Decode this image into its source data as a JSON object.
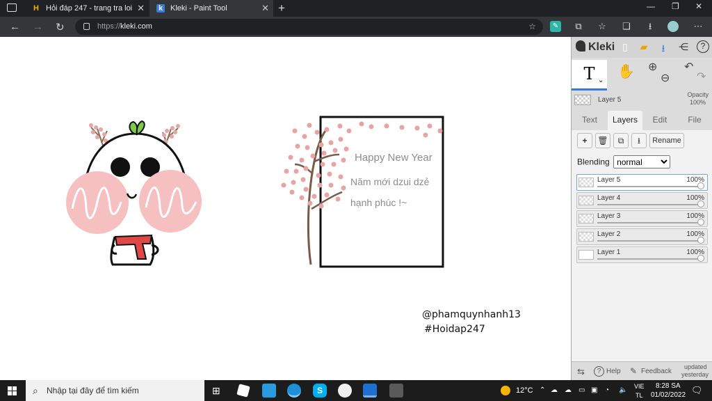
{
  "browser": {
    "tabs": [
      {
        "favicon": "hoidap-favicon",
        "title": "Hỏi đáp 247 - trang tra loi",
        "active": false
      },
      {
        "favicon": "kleki-favicon",
        "title": "Kleki - Paint Tool",
        "active": true
      }
    ],
    "new_tab_label": "+",
    "url_protocol": "https://",
    "url_host": "kleki.com"
  },
  "canvas": {
    "greeting_line1": "Happy New Year",
    "greeting_line2": "Năm mới dzui dzẻ",
    "greeting_line3": "hạnh phúc !~",
    "signature_line1": "@phamquynhanh13",
    "signature_line2": "#Hoidap247",
    "colors": {
      "blush": "#f7c0c0",
      "blossom": "#e8a3a3",
      "leaf": "#7ec850",
      "scarf": "#e04848",
      "branch": "#7a5a44"
    }
  },
  "kleki": {
    "app_name": "Kleki",
    "layer_name": "Layer 5",
    "opacity_label": "Opacity",
    "opacity_value": "100%",
    "tabs": [
      "Text",
      "Layers",
      "Edit",
      "File"
    ],
    "active_tab": "Layers",
    "rename_label": "Rename",
    "blending_label": "Blending",
    "blending_value": "normal",
    "layers": [
      {
        "name": "Layer 5",
        "opacity": "100%",
        "selected": true
      },
      {
        "name": "Layer 4",
        "opacity": "100%",
        "selected": false
      },
      {
        "name": "Layer 3",
        "opacity": "100%",
        "selected": false
      },
      {
        "name": "Layer 2",
        "opacity": "100%",
        "selected": false
      },
      {
        "name": "Layer 1",
        "opacity": "100%",
        "selected": false
      }
    ],
    "help_label": "Help",
    "feedback_label": "Feedback",
    "updated_line1": "updated",
    "updated_line2": "yesterday",
    "accent": "#3a7bd5"
  },
  "taskbar": {
    "search_placeholder": "Nhập tại đây để tìm kiếm",
    "temperature": "12°C",
    "lang_line1": "VIE",
    "lang_line2": "TL",
    "time": "8:28 SA",
    "date": "01/02/2022"
  }
}
